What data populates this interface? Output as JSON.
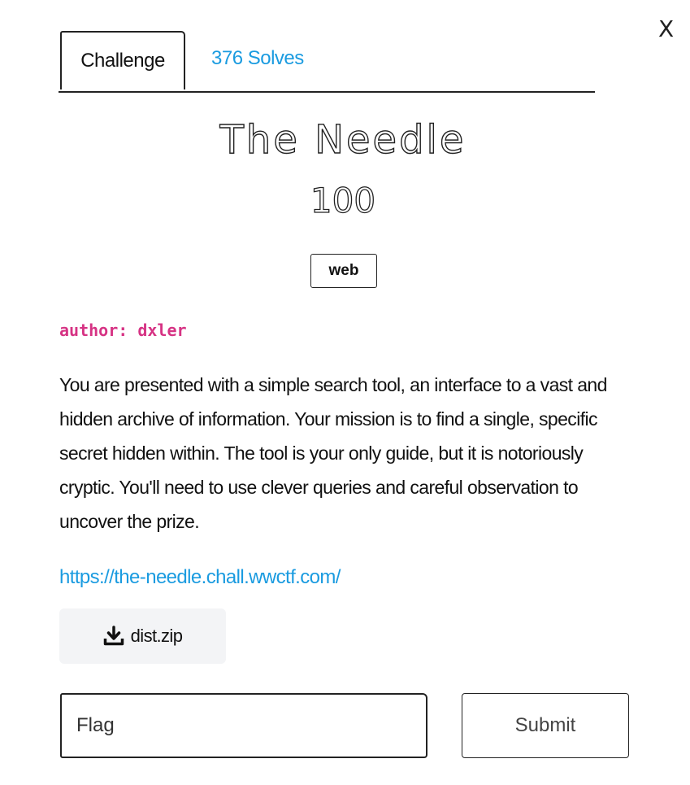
{
  "window": {
    "close_label": "X"
  },
  "tabs": {
    "challenge_label": "Challenge",
    "solves_label": "376 Solves"
  },
  "challenge": {
    "title": "The Needle",
    "points": "100",
    "category": "web",
    "author": "author: dxler",
    "description": "You are presented with a simple search tool, an interface to a vast and hidden archive of information. Your mission is to find a single, specific secret hidden within. The tool is your only guide, but it is notoriously cryptic. You'll need to use clever queries and careful observation to uncover the prize.",
    "url": "https://the-needle.chall.wwctf.com/",
    "attachment": {
      "icon": "download-icon",
      "filename": "dist.zip"
    }
  },
  "form": {
    "flag_placeholder": "Flag",
    "submit_label": "Submit"
  },
  "colors": {
    "link": "#1a9be0",
    "author": "#d63384",
    "download_bg": "#f3f4f6"
  }
}
